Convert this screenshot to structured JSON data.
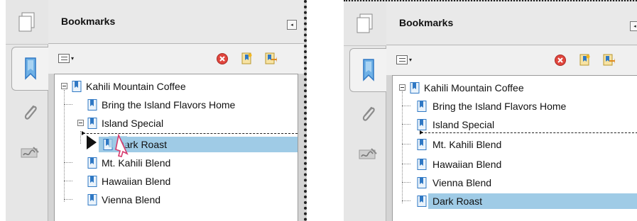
{
  "left_panel": {
    "title": "Bookmarks",
    "collapse_glyph": "◂",
    "options_caret": "▾",
    "tree": [
      {
        "label": "Kahili Mountain Coffee",
        "level": 0,
        "expander": "minus"
      },
      {
        "label": "Bring the Island Flavors Home",
        "level": 1
      },
      {
        "label": "Island Special",
        "level": 1,
        "expander": "minus"
      },
      {
        "label": "Dark Roast",
        "level": 2,
        "selected": true,
        "partially_obscured": true
      },
      {
        "label": "Mt. Kahili Blend",
        "level": 1
      },
      {
        "label": "Hawaiian Blend",
        "level": 1
      },
      {
        "label": "Vienna Blend",
        "level": 1
      }
    ],
    "drag_state": "dragging Dark Roast with cursor"
  },
  "right_panel": {
    "title": "Bookmarks",
    "collapse_glyph": "◂",
    "options_caret": "▾",
    "tree": [
      {
        "label": "Kahili Mountain Coffee",
        "level": 0,
        "expander": "minus"
      },
      {
        "label": "Bring the Island Flavors Home",
        "level": 1
      },
      {
        "label": "Island Special",
        "level": 1
      },
      {
        "label": "Mt. Kahili Blend",
        "level": 1
      },
      {
        "label": "Hawaiian Blend",
        "level": 1
      },
      {
        "label": "Vienna Blend",
        "level": 1
      },
      {
        "label": "Dark Roast",
        "level": 1,
        "selected": true
      }
    ]
  },
  "icons": {
    "pages": "pages-icon",
    "bookmark_tab": "bookmark-ribbon-icon",
    "attachments": "paperclip-icon",
    "signatures": "signature-icon",
    "options": "options-menu-icon",
    "delete": "delete-bookmark-icon",
    "new_bookmark": "new-bookmark-icon",
    "new_from_structure": "new-bookmark-from-structure-icon",
    "bookmark_item": "bookmark-page-icon"
  },
  "colors": {
    "selection": "#9fcbe6",
    "delete_red": "#e0453d",
    "drag_cursor": "#d63a6e",
    "bookmark_blue": "#2f78c4"
  }
}
